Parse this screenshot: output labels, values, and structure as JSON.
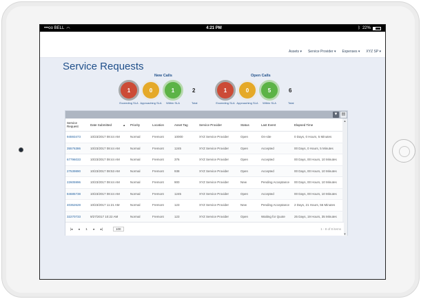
{
  "statusbar": {
    "carrier": "•••oo BELL",
    "wifi": "wifi",
    "time": "4:21 PM",
    "bluetooth": "bluetooth",
    "battery": "22%"
  },
  "nav": {
    "items": [
      "Assets ▾",
      "Service Provider ▾",
      "Expenses ▾",
      "XYZ SP ▾"
    ]
  },
  "page": {
    "title": "Service Requests"
  },
  "new_calls": {
    "title": "New Calls",
    "exceeding": "1",
    "approaching": "0",
    "within": "1",
    "total": "2",
    "exceeding_label": "Exceeding SLA",
    "approaching_label": "Approaching SLA",
    "within_label": "Within SLA",
    "total_label": "Total"
  },
  "open_calls": {
    "title": "Open Calls",
    "exceeding": "1",
    "approaching": "0",
    "within": "5",
    "total": "6",
    "exceeding_label": "Exceeding SLA",
    "approaching_label": "Approaching SLA",
    "within_label": "Within SLA",
    "total_label": "Total"
  },
  "toolbar": {
    "filter_icon": "filter-icon",
    "export_icon": "document-icon"
  },
  "table": {
    "headers": [
      "Service Request",
      "Date Submitted",
      "",
      "Priority",
      "Location",
      "Asset Tag",
      "Service Provider",
      "Status",
      "Last Event",
      "Elapsed Time"
    ],
    "rows": [
      [
        "94593473",
        "10/23/2017 08:44 AM",
        "Normal",
        "Fremont",
        "10000",
        "XYZ Service Provider",
        "Open",
        "On-site",
        "0 Days, 0 Hours, 5 Minutes"
      ],
      [
        "35576386",
        "10/23/2017 08:44 AM",
        "Normal",
        "Fremont",
        "1245",
        "XYZ Service Provider",
        "Open",
        "Accepted",
        "00 Days, 0 Hours, 5 Minutes"
      ],
      [
        "67796033",
        "10/23/2017 08:44 AM",
        "Normal",
        "Fremont",
        "376",
        "XYZ Service Provider",
        "Open",
        "Accepted",
        "00 Days, 00 Hours, 10 Minutes"
      ],
      [
        "27539890",
        "10/23/2017 08:53 AM",
        "Normal",
        "Fremont",
        "938",
        "XYZ Service Provider",
        "Open",
        "Accepted",
        "00 Days, 00 Hours, 10 Minutes"
      ],
      [
        "22605996",
        "10/23/2017 08:44 AM",
        "Normal",
        "Fremont",
        "900",
        "XYZ Service Provider",
        "New",
        "Pending Acceptance",
        "00 Days, 00 Hours, 10 Minutes"
      ],
      [
        "84685738",
        "10/23/2017 08:44 AM",
        "Normal",
        "Fremont",
        "1245",
        "XYZ Service Provider",
        "Open",
        "Accepted",
        "00 Days, 00 Hours, 10 Minutes"
      ],
      [
        "40352628",
        "10/23/2017 11:21 AM",
        "Normal",
        "Fremont",
        "123",
        "XYZ Service Provider",
        "New",
        "Pending Acceptance",
        "2 Days, 21 Hours, 56 Minutes"
      ],
      [
        "32270733",
        "9/27/2017 10:22 AM",
        "Normal",
        "Fremont",
        "123",
        "XYZ Service Provider",
        "Open",
        "Waiting for Quote",
        "25 Days, 19 Hours, 35 Minutes"
      ]
    ]
  },
  "pager": {
    "first": "|◂",
    "prev": "◂",
    "page": "1",
    "next": "▸",
    "last": "▸|",
    "page_size": "100",
    "info": "1 - 8 of 8 items"
  }
}
